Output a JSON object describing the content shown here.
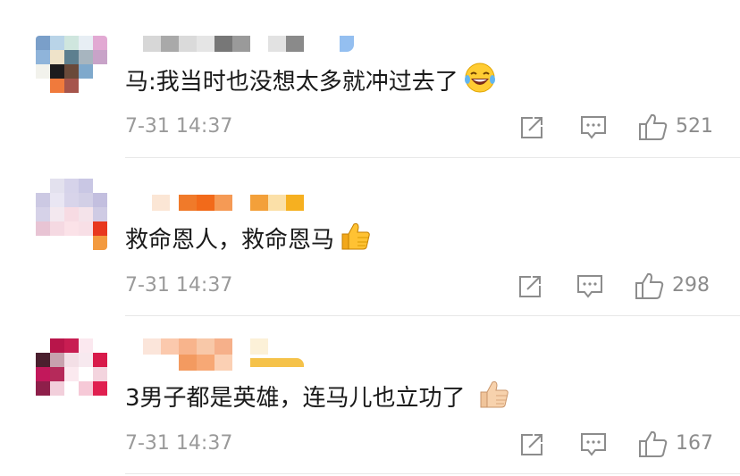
{
  "colors": {
    "text": "#1a1a1a",
    "meta": "#9a9a9a",
    "icon": "#8c8c8c",
    "divider": "#e8e8e8"
  },
  "comments": [
    {
      "text": "马:我当时也没想太多就冲过去了",
      "emoji": "laughing-tears-icon",
      "time": "7-31 14:37",
      "likes": "521"
    },
    {
      "text": "救命恩人，救命恩马",
      "emoji": "thumbs-up-icon",
      "time": "7-31 14:37",
      "likes": "298"
    },
    {
      "text": "3男子都是英雄，连马儿也立功了",
      "emoji": "thumbs-up-pale-icon",
      "time": "7-31 14:37",
      "likes": "167"
    }
  ]
}
